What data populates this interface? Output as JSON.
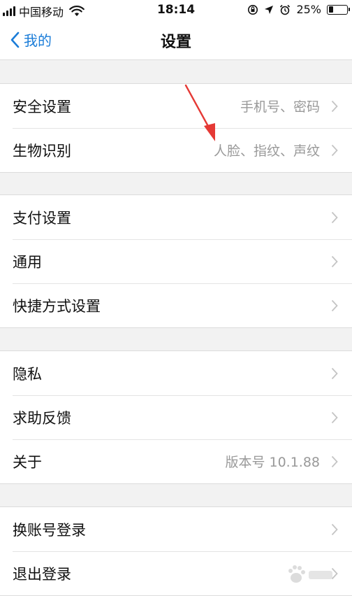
{
  "status_bar": {
    "carrier": "中国移动",
    "time": "18:14",
    "battery_percent": "25%",
    "battery_level": 0.25
  },
  "nav": {
    "back_label": "我的",
    "title": "设置"
  },
  "groups": [
    {
      "items": [
        {
          "label": "安全设置",
          "detail": "手机号、密码"
        },
        {
          "label": "生物识别",
          "detail": "人脸、指纹、声纹"
        }
      ]
    },
    {
      "items": [
        {
          "label": "支付设置",
          "detail": ""
        },
        {
          "label": "通用",
          "detail": ""
        },
        {
          "label": "快捷方式设置",
          "detail": ""
        }
      ]
    },
    {
      "items": [
        {
          "label": "隐私",
          "detail": ""
        },
        {
          "label": "求助反馈",
          "detail": ""
        },
        {
          "label": "关于",
          "detail": "版本号 10.1.88"
        }
      ]
    },
    {
      "items": [
        {
          "label": "换账号登录",
          "detail": ""
        },
        {
          "label": "退出登录",
          "detail": ""
        }
      ]
    }
  ],
  "colors": {
    "accent": "#1a7cd8",
    "annotation": "#e53935",
    "background": "#f2f2f2"
  }
}
